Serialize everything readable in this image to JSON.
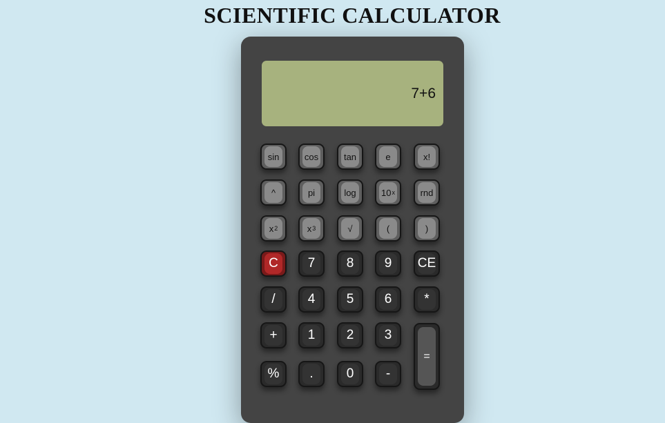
{
  "title": "SCIENTIFIC CALCULATOR",
  "display": "7+6",
  "keys": {
    "sin": "sin",
    "cos": "cos",
    "tan": "tan",
    "e": "e",
    "fact": "x!",
    "pow": "^",
    "pi": "pi",
    "log": "log",
    "ten_base": "10",
    "ten_exp": "x",
    "rnd": "rnd",
    "sq_base": "x",
    "sq_exp": "2",
    "cube_base": "x",
    "cube_exp": "3",
    "sqrt": "√",
    "lparen": "(",
    "rparen": ")",
    "clear": "C",
    "seven": "7",
    "eight": "8",
    "nine": "9",
    "clear_entry": "CE",
    "divide": "/",
    "four": "4",
    "five": "5",
    "six": "6",
    "multiply": "*",
    "plus": "+",
    "one": "1",
    "two": "2",
    "three": "3",
    "equals": "=",
    "percent": "%",
    "dot": ".",
    "zero": "0",
    "minus": "-"
  }
}
